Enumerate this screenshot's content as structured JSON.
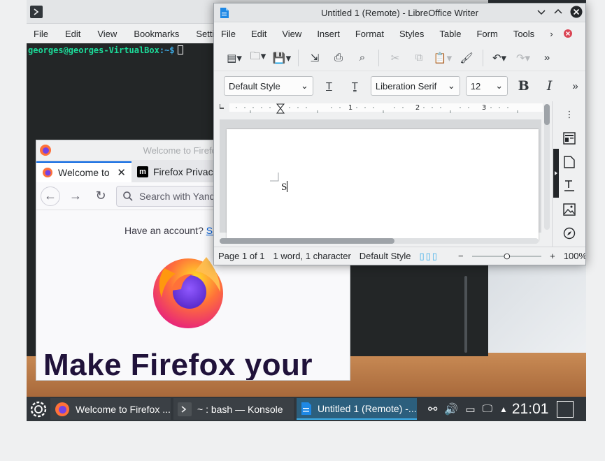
{
  "konsole": {
    "menu": [
      "File",
      "Edit",
      "View",
      "Bookmarks",
      "Settings"
    ],
    "prompt_user": "georges@georges-VirtualBox",
    "prompt_path": ":~$"
  },
  "firefox": {
    "window_title": "Welcome to Firefox — M",
    "tabs": [
      {
        "label": "Welcome to"
      },
      {
        "label": "Firefox Privac"
      }
    ],
    "url_placeholder": "Search with Yande",
    "account_text": "Have an account?",
    "account_link": "Sig",
    "hero": "Make Firefox your"
  },
  "writer": {
    "window_title": "Untitled 1 (Remote) - LibreOffice Writer",
    "menu": [
      "File",
      "Edit",
      "View",
      "Insert",
      "Format",
      "Styles",
      "Table",
      "Form",
      "Tools"
    ],
    "style": "Default Style",
    "font": "Liberation Serif",
    "size": "12",
    "ruler_marks": [
      "1",
      "2",
      "3"
    ],
    "doc_text": "S",
    "status": {
      "page": "Page 1 of 1",
      "words": "1 word, 1 character",
      "style": "Default Style",
      "zoom_minus": "−",
      "zoom_plus": "+",
      "zoom": "100%"
    }
  },
  "taskbar": {
    "tasks": [
      {
        "label": "Welcome to Firefox ..."
      },
      {
        "label": "~ : bash — Konsole"
      },
      {
        "label": "Untitled 1 (Remote) -..."
      }
    ],
    "clock": "21:01"
  },
  "colors": {
    "accent": "#3daee9",
    "firefox_link": "#0060df",
    "terminal_bg": "#232627",
    "taskbar_bg": "#31363b"
  }
}
